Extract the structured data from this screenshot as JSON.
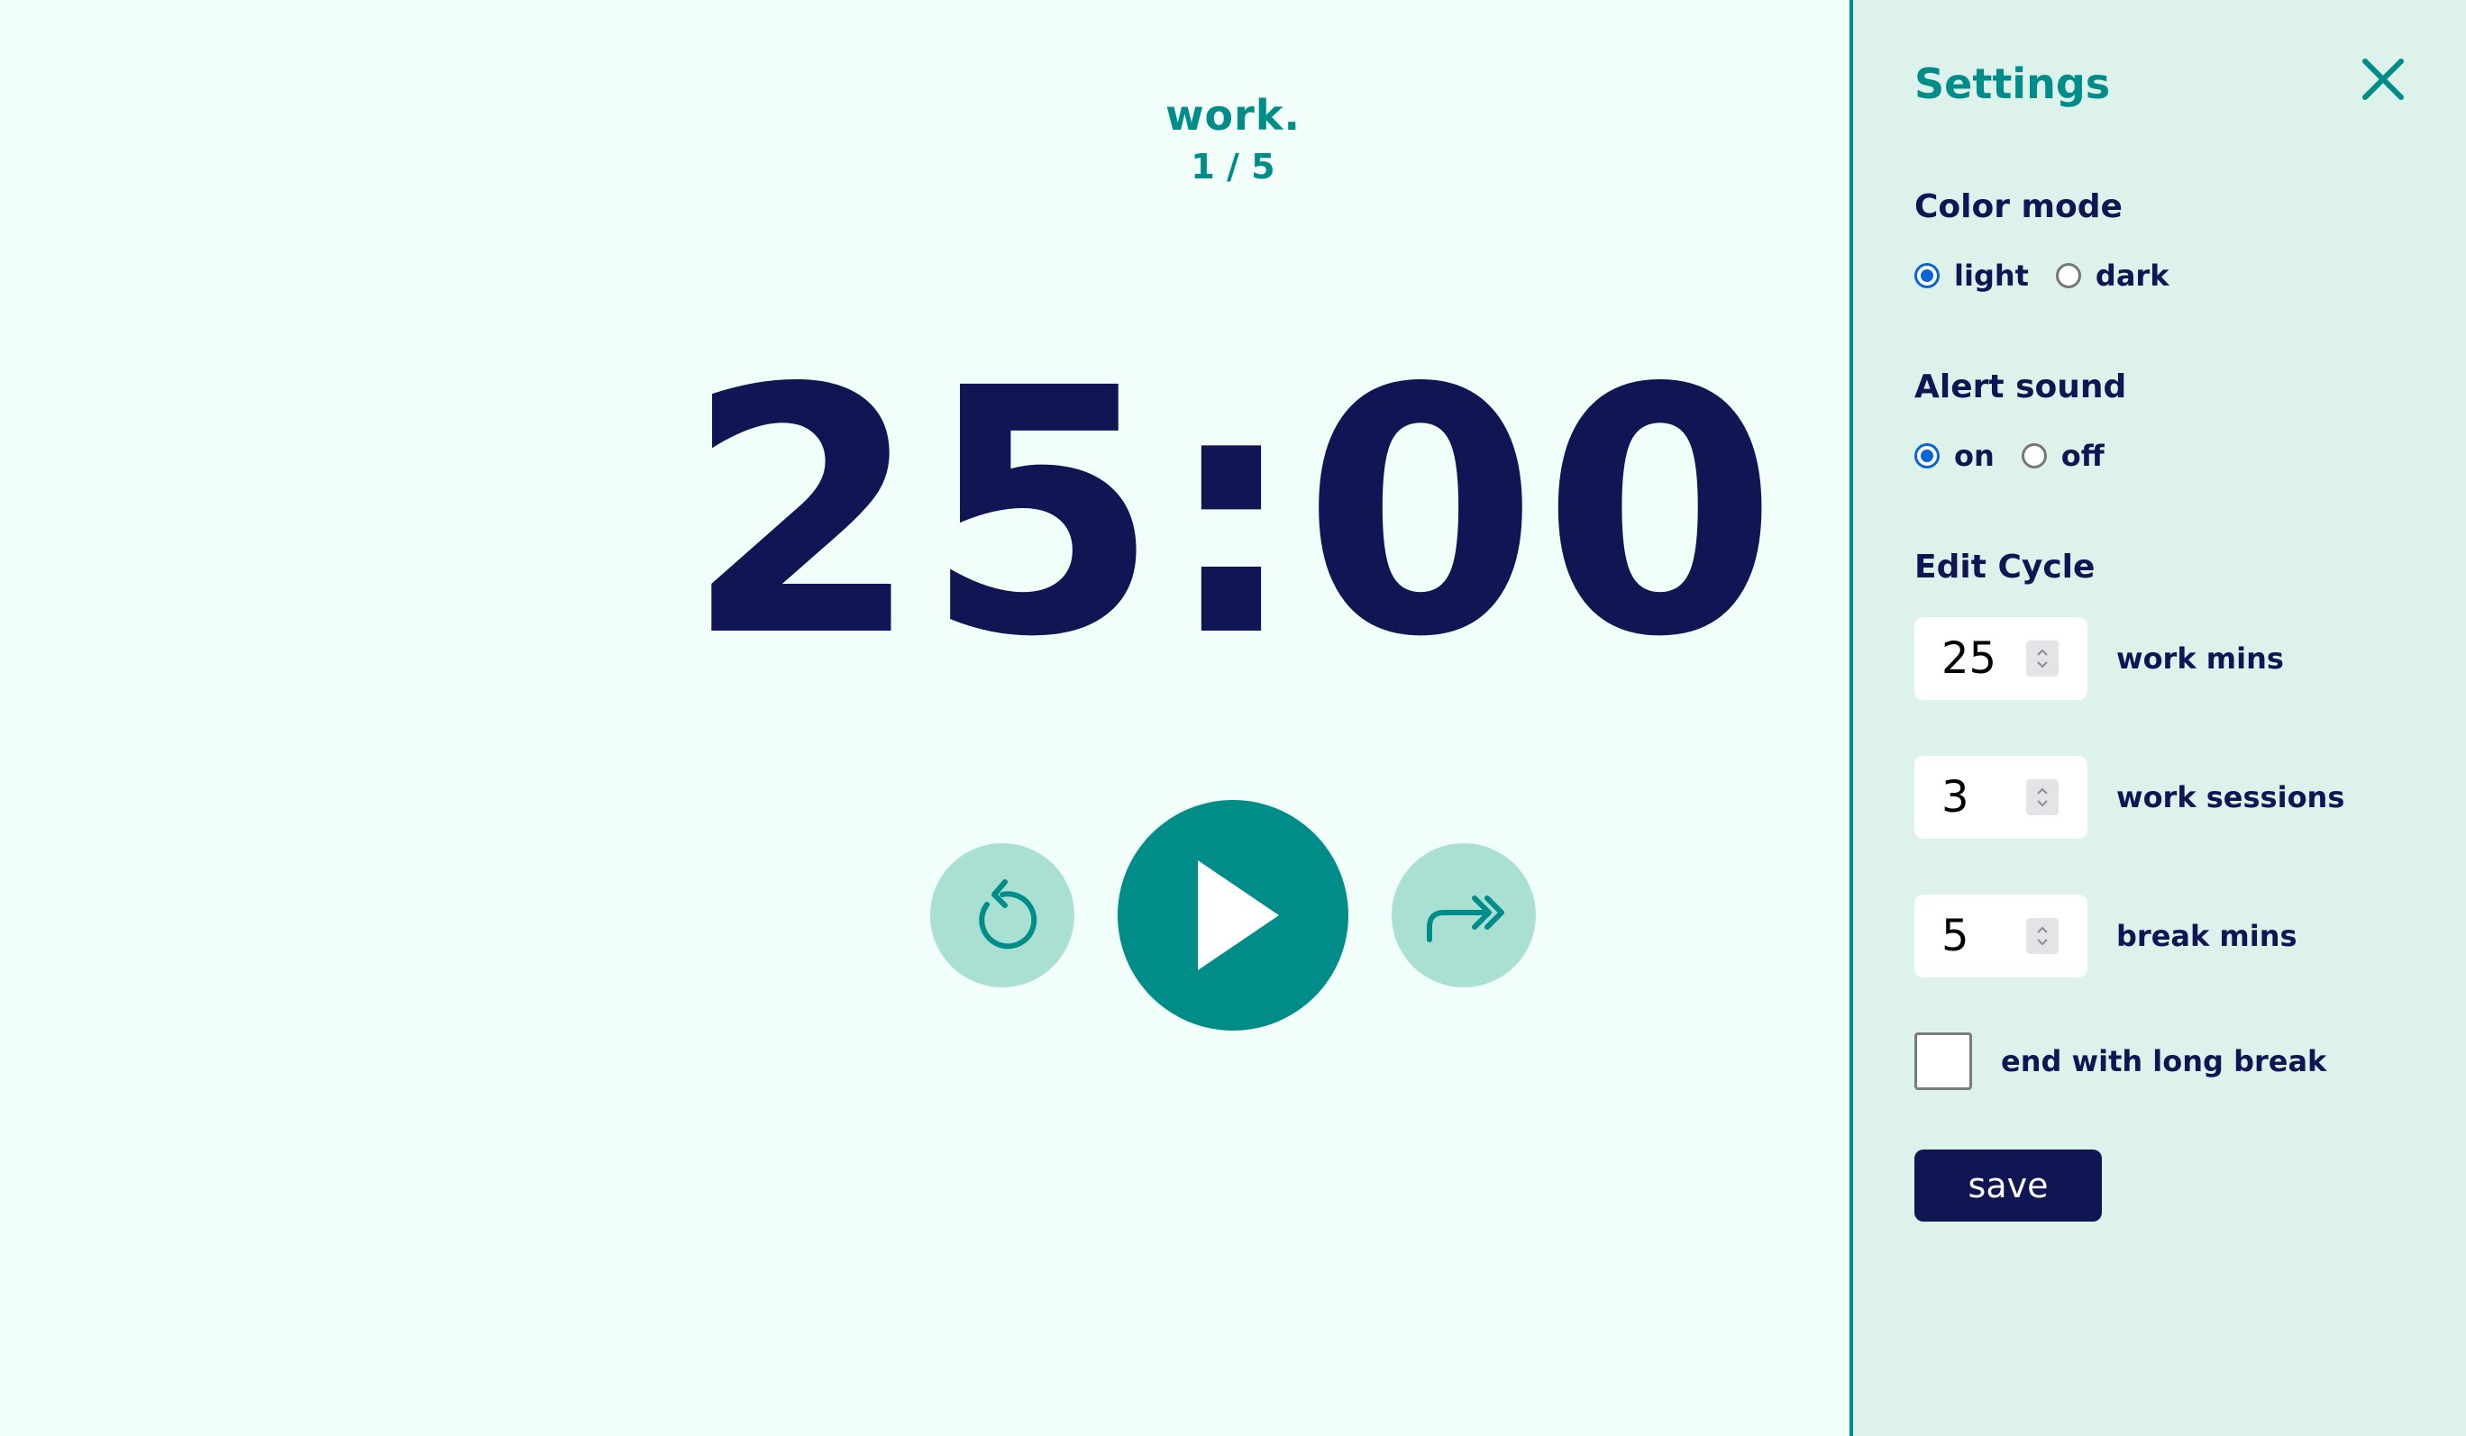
{
  "colors": {
    "teal": "#008d8a",
    "navy": "#101654",
    "mint_background": "#f2fefa",
    "panel_background": "#def2ec",
    "control_secondary": "#aae0d3",
    "radio_blue": "#0b63d6"
  },
  "timer": {
    "phase": "work.",
    "session_progress": "1 / 5",
    "time_display": "25:00",
    "controls": {
      "restart_icon": "restart-icon",
      "play_icon": "play-icon",
      "skip_icon": "skip-forward-icon"
    }
  },
  "settings": {
    "title": "Settings",
    "close_icon": "close-icon",
    "color_mode": {
      "label": "Color mode",
      "options": [
        {
          "label": "light",
          "checked": true
        },
        {
          "label": "dark",
          "checked": false
        }
      ]
    },
    "alert_sound": {
      "label": "Alert sound",
      "options": [
        {
          "label": "on",
          "checked": true
        },
        {
          "label": "off",
          "checked": false
        }
      ]
    },
    "edit_cycle": {
      "label": "Edit Cycle",
      "fields": [
        {
          "value": "25",
          "label": "work mins"
        },
        {
          "value": "3",
          "label": "work sessions"
        },
        {
          "value": "5",
          "label": "break mins"
        }
      ],
      "long_break": {
        "label": "end with long break",
        "checked": false
      }
    },
    "save_label": "save"
  }
}
